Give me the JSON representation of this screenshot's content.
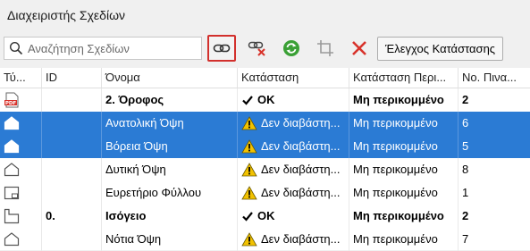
{
  "window": {
    "title": "Διαχειριστής Σχεδίων"
  },
  "toolbar": {
    "search_placeholder": "Αναζήτηση Σχεδίων",
    "check_status_label": "Έλεγχος Κατάστασης"
  },
  "columns": {
    "type": "Τύ...",
    "id": "ID",
    "name": "Όνομα",
    "status": "Κατάσταση",
    "clip_status": "Κατάσταση Περι...",
    "sheet_no": "Νο. Πινα..."
  },
  "rows": [
    {
      "type_icon": "pdf-icon",
      "id": "",
      "name": "2. Όροφος",
      "status_icon": "checkmark-icon",
      "status": "OK",
      "clip": "Μη περικομμένο",
      "sheet": "2",
      "bold": true,
      "selected": false
    },
    {
      "type_icon": "elevation-icon",
      "id": "",
      "name": "Ανατολική Όψη",
      "status_icon": "warning-icon",
      "status": "Δεν διαβάστη...",
      "clip": "Μη περικομμένο",
      "sheet": "6",
      "bold": false,
      "selected": true
    },
    {
      "type_icon": "elevation-icon",
      "id": "",
      "name": "Βόρεια Όψη",
      "status_icon": "warning-icon",
      "status": "Δεν διαβάστη...",
      "clip": "Μη περικομμένο",
      "sheet": "5",
      "bold": false,
      "selected": true
    },
    {
      "type_icon": "elevation-icon",
      "id": "",
      "name": "Δυτική Όψη",
      "status_icon": "warning-icon",
      "status": "Δεν διαβάστη...",
      "clip": "Μη περικομμένο",
      "sheet": "8",
      "bold": false,
      "selected": false
    },
    {
      "type_icon": "index-sheet-icon",
      "id": "",
      "name": "Ευρετήριο Φύλλου",
      "status_icon": "warning-icon",
      "status": "Δεν διαβάστη...",
      "clip": "Μη περικομμένο",
      "sheet": "1",
      "bold": false,
      "selected": false
    },
    {
      "type_icon": "floor-plan-icon",
      "id": "0.",
      "name": "Ισόγειο",
      "status_icon": "checkmark-icon",
      "status": "OK",
      "clip": "Μη περικομμένο",
      "sheet": "2",
      "bold": true,
      "selected": false
    },
    {
      "type_icon": "elevation-icon",
      "id": "",
      "name": "Νότια Όψη",
      "status_icon": "warning-icon",
      "status": "Δεν διαβάστη...",
      "clip": "Μη περικομμένο",
      "sheet": "7",
      "bold": false,
      "selected": false
    }
  ],
  "colors": {
    "selection": "#2b7bd4",
    "highlight_border": "#d2302c",
    "warning": "#f2c200",
    "refresh": "#3aa035",
    "delete": "#d8322a"
  }
}
